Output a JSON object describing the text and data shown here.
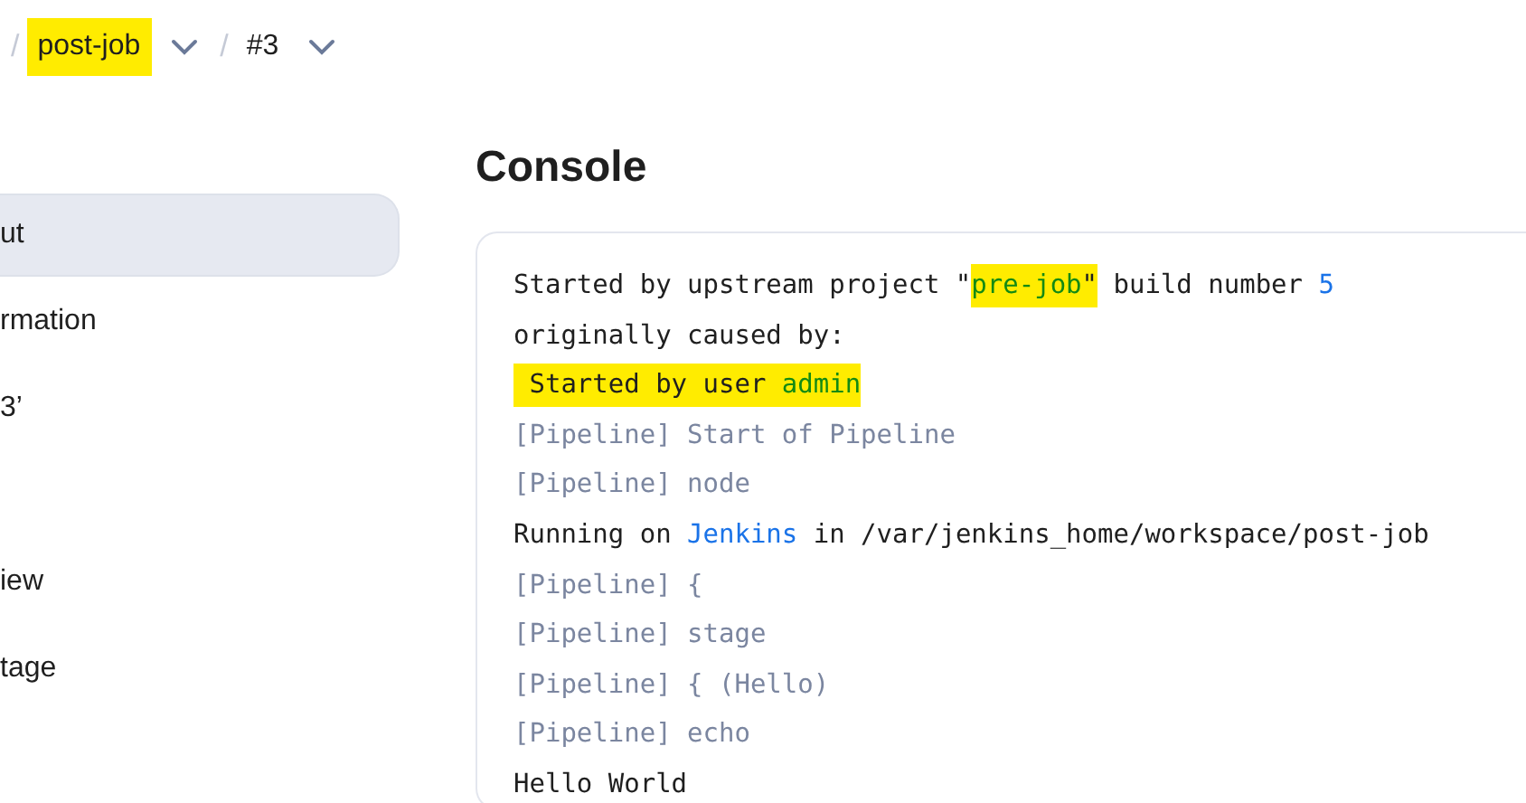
{
  "breadcrumbs": [
    {
      "separator": "/",
      "label": "post-job",
      "highlighted": true
    },
    {
      "separator": "/",
      "label": "#3",
      "highlighted": false
    }
  ],
  "sidebar": {
    "items": [
      {
        "label": "ut",
        "selected": true
      },
      {
        "label": "rmation",
        "selected": false
      },
      {
        "label": "3’",
        "selected": false
      },
      {
        "label": "iew",
        "selected": false
      },
      {
        "label": "tage",
        "selected": false
      }
    ]
  },
  "console": {
    "title": "Console",
    "lines": [
      {
        "segments": [
          {
            "kind": "plain",
            "text": "Started by upstream project \"",
            "highlighted": false
          },
          {
            "kind": "job",
            "text": "pre-job",
            "highlighted": true
          },
          {
            "kind": "plain",
            "text": "\"",
            "highlighted": true
          },
          {
            "kind": "plain",
            "text": " build number ",
            "highlighted": false
          },
          {
            "kind": "link",
            "text": "5",
            "highlighted": false
          }
        ]
      },
      {
        "segments": [
          {
            "kind": "plain",
            "text": "originally caused by:",
            "highlighted": false
          }
        ]
      },
      {
        "segments": [
          {
            "kind": "plain",
            "text": " Started by user ",
            "highlighted": true
          },
          {
            "kind": "job",
            "text": "admin",
            "highlighted": true
          }
        ]
      },
      {
        "segments": [
          {
            "kind": "pipeline",
            "text": "[Pipeline] Start of Pipeline",
            "highlighted": false
          }
        ]
      },
      {
        "segments": [
          {
            "kind": "pipeline",
            "text": "[Pipeline] node",
            "highlighted": false
          }
        ]
      },
      {
        "segments": [
          {
            "kind": "plain",
            "text": "Running on ",
            "highlighted": false
          },
          {
            "kind": "link",
            "text": "Jenkins",
            "highlighted": false
          },
          {
            "kind": "plain",
            "text": " in /var/jenkins_home/workspace/post-job",
            "highlighted": false
          }
        ]
      },
      {
        "segments": [
          {
            "kind": "pipeline",
            "text": "[Pipeline] {",
            "highlighted": false
          }
        ]
      },
      {
        "segments": [
          {
            "kind": "pipeline",
            "text": "[Pipeline] stage",
            "highlighted": false
          }
        ]
      },
      {
        "segments": [
          {
            "kind": "pipeline",
            "text": "[Pipeline] { (Hello)",
            "highlighted": false
          }
        ]
      },
      {
        "segments": [
          {
            "kind": "pipeline",
            "text": "[Pipeline] echo",
            "highlighted": false
          }
        ]
      },
      {
        "segments": [
          {
            "kind": "plain",
            "text": "Hello World",
            "highlighted": false
          }
        ]
      }
    ]
  }
}
